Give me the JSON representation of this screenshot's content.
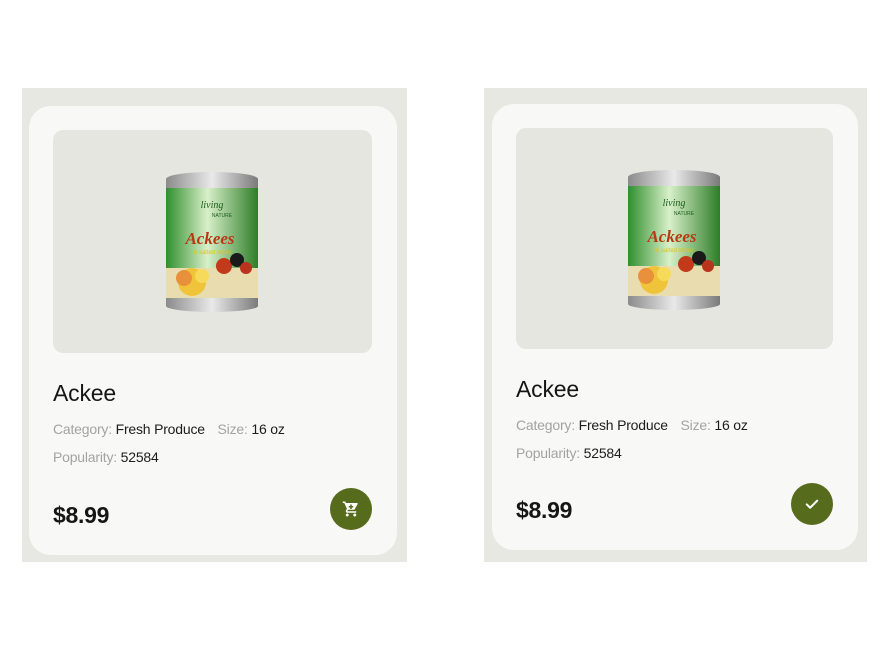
{
  "cards": [
    {
      "name": "Ackee",
      "category_label": "Category:",
      "category_value": "Fresh Produce",
      "size_label": "Size:",
      "size_value": "16 oz",
      "popularity_label": "Popularity:",
      "popularity_value": "52584",
      "price": "$8.99",
      "action_icon": "cart-icon",
      "can": {
        "brand_line1": "living",
        "brand_line2": "NATURE",
        "label": "Ackees",
        "sublabel": "in salted water"
      }
    },
    {
      "name": "Ackee",
      "category_label": "Category:",
      "category_value": "Fresh Produce",
      "size_label": "Size:",
      "size_value": "16 oz",
      "popularity_label": "Popularity:",
      "popularity_value": "52584",
      "price": "$8.99",
      "action_icon": "check-icon",
      "can": {
        "brand_line1": "living",
        "brand_line2": "NATURE",
        "label": "Ackees",
        "sublabel": "in salted water"
      }
    }
  ],
  "colors": {
    "accent": "#566c1c",
    "panel": "#e8e8e2",
    "card": "#f8f8f6"
  }
}
